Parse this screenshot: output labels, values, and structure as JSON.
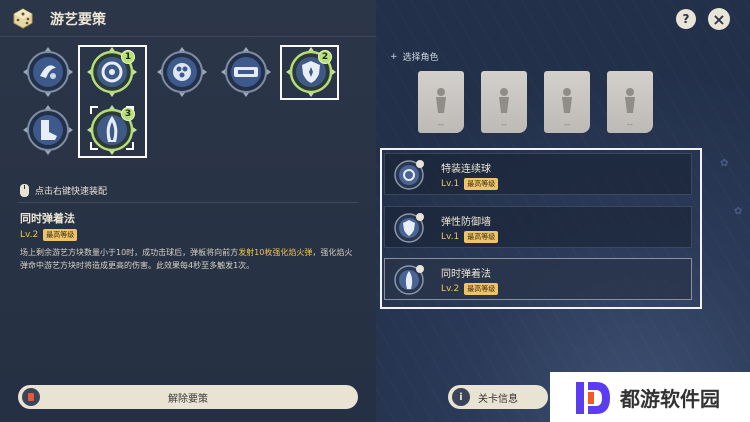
{
  "header": {
    "title": "游艺要策",
    "help_label": "?",
    "close_label": "×"
  },
  "strategies": {
    "badges": [
      "1",
      "2",
      "3"
    ],
    "hint": "点击右键快速装配",
    "unequip_label": "解除要策"
  },
  "detail": {
    "name": "同时弹着法",
    "level": "Lv.2",
    "max_tag": "最高等级",
    "desc_before": "场上剩余游艺方块数量小于10时，成功击球后，弹板将向前方",
    "desc_highlight": "发射10枚强化焰火弹",
    "desc_after": "，强化焰火弹命中游艺方块时将造成更高的伤害。此效果每4秒至多触发1次。"
  },
  "right_panel": {
    "select_role": "选择角色",
    "slots": [
      "--",
      "--",
      "--",
      "--"
    ],
    "equipped": [
      {
        "name": "特装连续球",
        "level": "Lv.1",
        "tag": "最高等级"
      },
      {
        "name": "弹性防御墙",
        "level": "Lv.1",
        "tag": "最高等级"
      },
      {
        "name": "同时弹着法",
        "level": "Lv.2",
        "tag": "最高等级"
      }
    ],
    "info_label": "关卡信息",
    "info_icon": "i"
  },
  "watermark": {
    "text": "都游软件园"
  }
}
